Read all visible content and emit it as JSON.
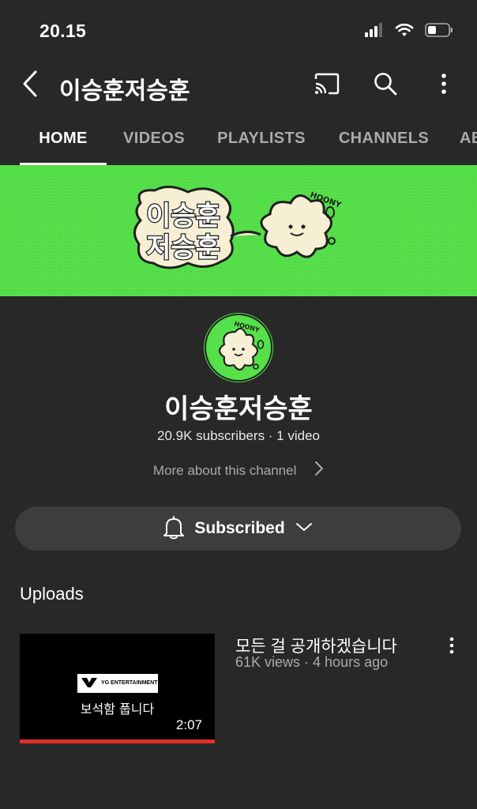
{
  "status_bar": {
    "time": "20.15",
    "icons": [
      "cellular-signal-icon",
      "wifi-icon",
      "battery-icon"
    ]
  },
  "app_bar": {
    "title": "이승훈저승훈",
    "icons": [
      "back-chevron-icon",
      "cast-icon",
      "search-icon",
      "more-vertical-icon"
    ]
  },
  "tabs": [
    {
      "label": "HOME",
      "active": true
    },
    {
      "label": "VIDEOS",
      "active": false
    },
    {
      "label": "PLAYLISTS",
      "active": false
    },
    {
      "label": "CHANNELS",
      "active": false
    },
    {
      "label": "AB",
      "active": false
    }
  ],
  "banner": {
    "lettering": "이승훈 저승훈",
    "mascot_tag": "HOONY"
  },
  "channel": {
    "name": "이승훈저승훈",
    "stats": "20.9K subscribers · 1 video",
    "more_about": "More about this channel"
  },
  "subscribe_button": {
    "label": "Subscribed",
    "icons": [
      "bell-icon",
      "chevron-down-icon"
    ]
  },
  "uploads": {
    "title": "Uploads",
    "videos": [
      {
        "title": "모든 걸 공개하겠습니다",
        "meta": "61K views · 4 hours ago",
        "duration": "2:07",
        "thumbnail_caption": "보석함 풉니다",
        "thumbnail_logo": "YG ENTERTAINMENT",
        "watched_fraction": 1.0
      }
    ]
  },
  "colors": {
    "background": "#282828",
    "banner_green": "#56e04a",
    "subscribe_bg": "#3d3d3d",
    "progress_red": "#e52d27",
    "muted_text": "#aaaaaa"
  }
}
